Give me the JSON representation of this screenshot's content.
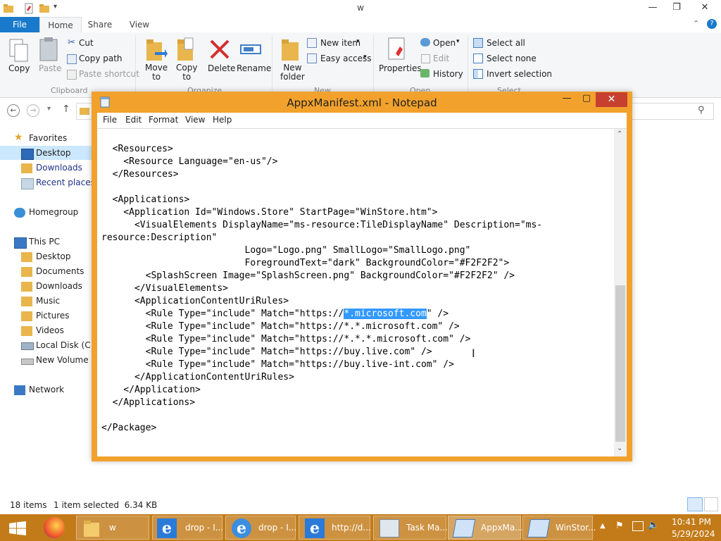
{
  "explorer": {
    "window_title": "w",
    "tabs": {
      "file": "File",
      "home": "Home",
      "share": "Share",
      "view": "View"
    },
    "ribbon": {
      "copy": "Copy",
      "paste": "Paste",
      "cut": "Cut",
      "copy_path": "Copy path",
      "paste_shortcut": "Paste shortcut",
      "clipboard_group": "Clipboard",
      "move_to": "Move\nto",
      "copy_to": "Copy\nto",
      "delete": "Delete",
      "rename": "Rename",
      "organize_group": "Organize",
      "new_folder": "New\nfolder",
      "new_item": "New item",
      "easy_access": "Easy access",
      "new_group": "New",
      "properties": "Properties",
      "open": "Open",
      "edit": "Edit",
      "history": "History",
      "open_group": "Open",
      "select_all": "Select all",
      "select_none": "Select none",
      "invert_selection": "Invert selection",
      "select_group": "Select"
    },
    "nav_pane": {
      "favorites": "Favorites",
      "desktop": "Desktop",
      "downloads": "Downloads",
      "recent_places": "Recent places",
      "homegroup": "Homegroup",
      "this_pc": "This PC",
      "pc_desktop": "Desktop",
      "documents": "Documents",
      "pc_downloads": "Downloads",
      "music": "Music",
      "pictures": "Pictures",
      "videos": "Videos",
      "local_disk": "Local Disk (C:)",
      "new_volume": "New Volume (D",
      "network": "Network"
    },
    "status": {
      "items": "18 items",
      "selected": "1 item selected  6.34 KB"
    }
  },
  "notepad": {
    "title": "AppxManifest.xml - Notepad",
    "menu": {
      "file": "File",
      "edit": "Edit",
      "format": "Format",
      "view": "View",
      "help": "Help"
    },
    "lines_before": "  <Resources>\n    <Resource Language=\"en-us\"/>\n  </Resources>\n\n  <Applications>\n    <Application Id=\"Windows.Store\" StartPage=\"WinStore.htm\">\n      <VisualElements DisplayName=\"ms-resource:TileDisplayName\" Description=\"ms-\nresource:Description\"\n                          Logo=\"Logo.png\" SmallLogo=\"SmallLogo.png\"\n                          ForegroundText=\"dark\" BackgroundColor=\"#F2F2F2\">\n        <SplashScreen Image=\"SplashScreen.png\" BackgroundColor=\"#F2F2F2\" />\n      </VisualElements>\n      <ApplicationContentUriRules>\n        <Rule Type=\"include\" Match=\"https://",
    "selected_text": "*.microsoft.com",
    "lines_after": "\" />\n        <Rule Type=\"include\" Match=\"https://*.*.microsoft.com\" />\n        <Rule Type=\"include\" Match=\"https://*.*.*.microsoft.com\" />\n        <Rule Type=\"include\" Match=\"https://buy.live.com\" />\n        <Rule Type=\"include\" Match=\"https://buy.live-int.com\" />\n      </ApplicationContentUriRules>\n    </Application>\n  </Applications>\n\n</Package>"
  },
  "taskbar": {
    "items": [
      {
        "label": "w"
      },
      {
        "label": "drop - I..."
      },
      {
        "label": "drop - I..."
      },
      {
        "label": "http://d..."
      },
      {
        "label": "Task Ma..."
      },
      {
        "label": "AppxMa..."
      },
      {
        "label": "WinStor..."
      }
    ],
    "clock_time": "10:41 PM",
    "clock_date": "5/29/2024"
  },
  "colors": {
    "taskbar": "#c27b18",
    "notepad_frame": "#f2a22c",
    "file_tab": "#1979ca",
    "close": "#c7402f"
  }
}
